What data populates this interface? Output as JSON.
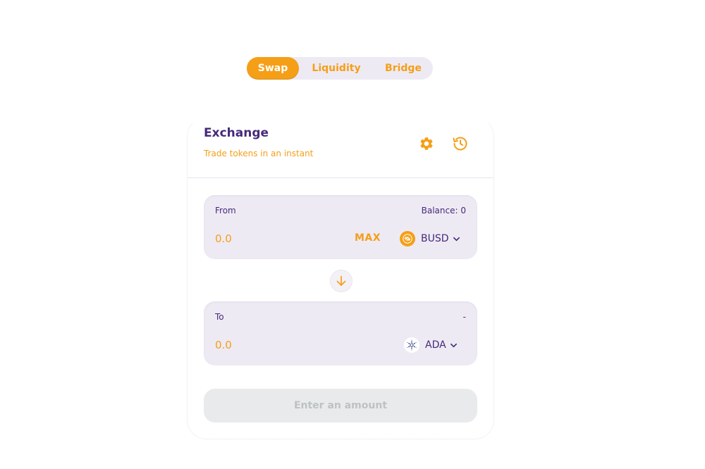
{
  "nav": {
    "tabs": [
      {
        "label": "Swap",
        "active": true
      },
      {
        "label": "Liquidity",
        "active": false
      },
      {
        "label": "Bridge",
        "active": false
      }
    ]
  },
  "card": {
    "title": "Exchange",
    "subtitle": "Trade tokens in an instant",
    "icons": {
      "settings": "gear-icon",
      "history": "history-icon"
    }
  },
  "from_panel": {
    "label": "From",
    "balance_text": "Balance: 0",
    "amount_placeholder": "0.0",
    "max_label": "MAX",
    "token": {
      "symbol": "BUSD",
      "icon": "busd-token-icon"
    }
  },
  "swap_icon": "arrow-down-icon",
  "to_panel": {
    "label": "To",
    "right_text": "-",
    "amount_placeholder": "0.0",
    "token": {
      "symbol": "ADA",
      "icon": "ada-token-icon"
    }
  },
  "submit": {
    "label": "Enter an amount",
    "disabled": true
  },
  "colors": {
    "accent": "#f59f17",
    "primary_text": "#452a7a",
    "panel_bg": "#eeeaf4",
    "disabled_bg": "#e9eaeb",
    "disabled_text": "#bdc2c4"
  }
}
